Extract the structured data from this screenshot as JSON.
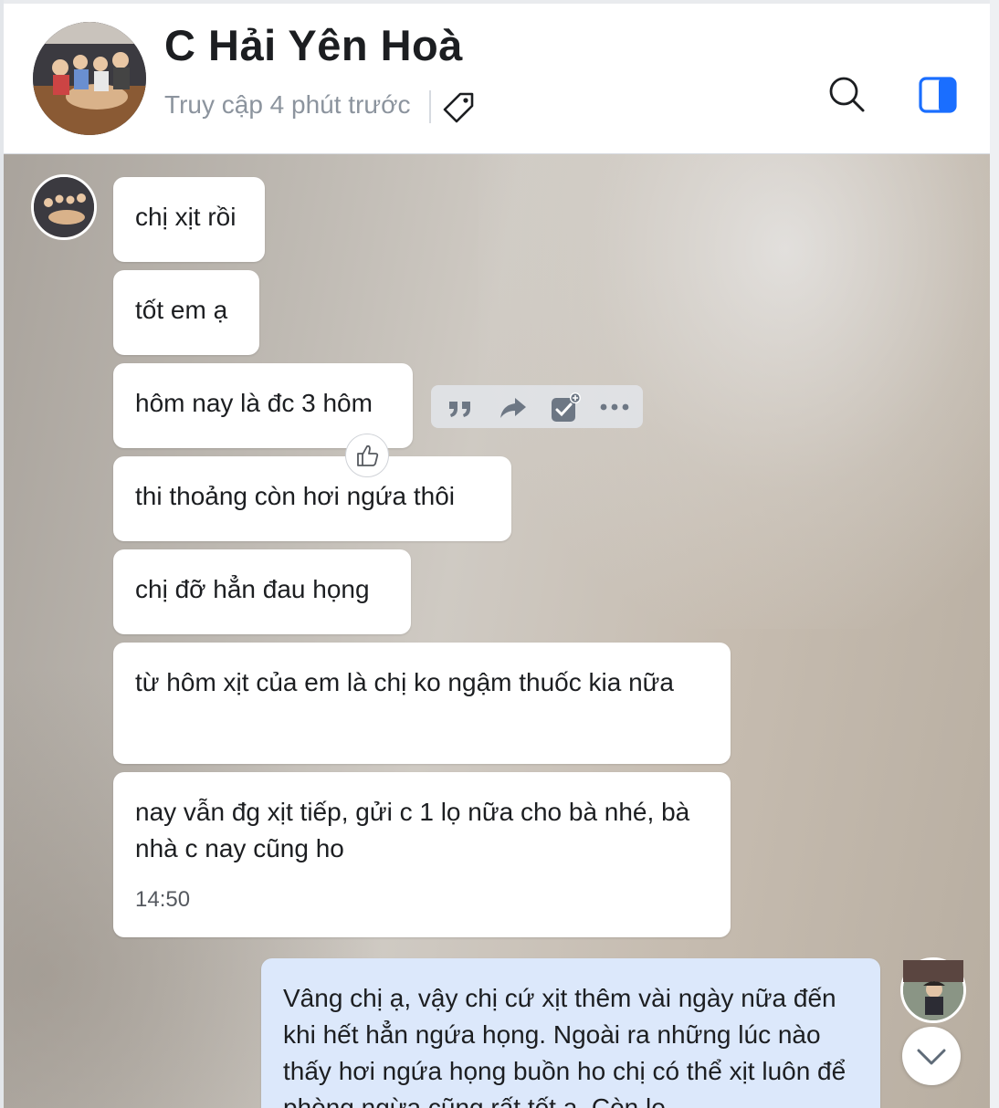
{
  "header": {
    "contact_name": "C Hải Yên Hoà",
    "last_seen": "Truy cập 4 phút trước"
  },
  "icons": {
    "tag": "tag-icon",
    "search": "search-icon",
    "panel": "panel-toggle-icon",
    "quote": "quote-icon",
    "forward": "forward-icon",
    "add_task": "add-task-icon",
    "more": "more-icon",
    "like": "thumbs-up-icon",
    "scroll_down": "chevron-down-icon"
  },
  "colors": {
    "accent": "#1a6eff",
    "my_bubble": "#dce8fb",
    "their_bubble": "#ffffff"
  },
  "messages": [
    {
      "text": "chị xịt rồi"
    },
    {
      "text": "tốt em ạ"
    },
    {
      "text": "hôm nay là đc 3 hôm"
    },
    {
      "text": "thi thoảng còn hơi ngứa thôi"
    },
    {
      "text": "chị đỡ hẳn đau họng"
    },
    {
      "text": "từ hôm xịt của em là chị ko ngậm thuốc kia nữa"
    },
    {
      "text": "nay vẫn đg xịt tiếp, gửi c 1 lọ nữa cho bà nhé, bà nhà c nay cũng ho",
      "time": "14:50"
    }
  ],
  "my_message": {
    "text": "Vâng chị ạ, vậy chị cứ xịt thêm vài ngày nữa đến khi hết hẳn ngứa họng. Ngoài ra những lúc nào thấy hơi ngứa họng buồn ho chị có thể xịt luôn để phòng ngừa cũng rất tốt ạ. Còn lọ"
  }
}
